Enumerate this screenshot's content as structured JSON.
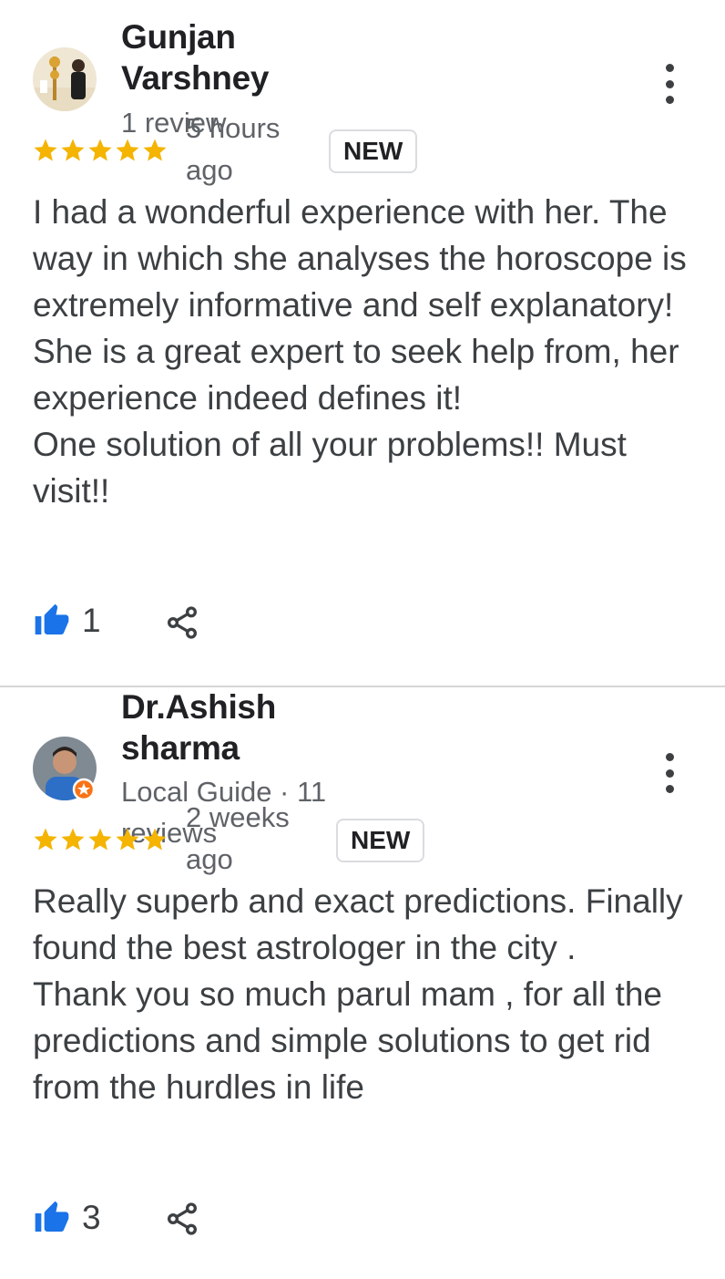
{
  "reviews": [
    {
      "author": "Gunjan Varshney",
      "meta": "1 review",
      "rating": 5,
      "time": "5 hours ago",
      "badge": "NEW",
      "text": "I had a wonderful experience with her. The way in which she analyses the horoscope is extremely informative and self explanatory!\nShe is a great expert to seek help from, her experience indeed defines it!\nOne solution of all your problems!! Must visit!!",
      "likes": "1"
    },
    {
      "author": "Dr.Ashish sharma",
      "meta": "Local Guide · 11 reviews",
      "rating": 5,
      "time": "2 weeks ago",
      "badge": "NEW",
      "text": "Really superb and exact predictions. Finally found the best astrologer in the city .\nThank you so much parul mam , for all the predictions and simple solutions to get rid from the hurdles in life",
      "likes": "3"
    }
  ],
  "colors": {
    "star": "#f4b400",
    "like": "#1a73e8",
    "local_guide_badge": "#f97316"
  },
  "icons": {
    "rating": "star-icon",
    "like": "thumbs-up-icon",
    "share": "share-icon",
    "menu": "more-vert-icon"
  }
}
